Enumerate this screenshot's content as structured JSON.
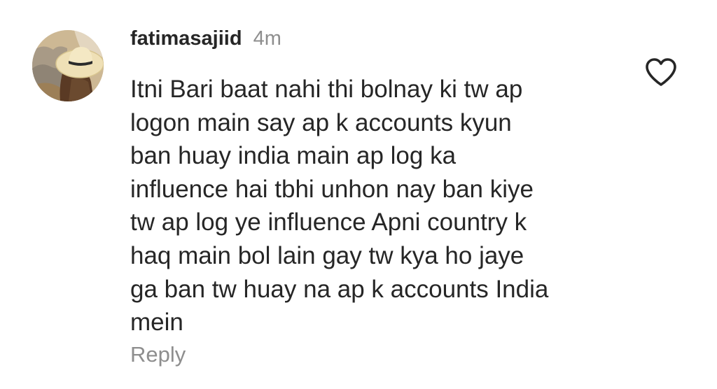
{
  "comment": {
    "username": "fatimasajiid",
    "timestamp": "4m",
    "text_lines": [
      "Itni Bari baat nahi thi bolnay ki tw ap",
      "logon main say ap k accounts kyun",
      "ban huay india main ap log ka",
      "influence hai tbhi unhon nay ban kiye",
      "tw ap log ye influence Apni country k",
      "haq main bol lain gay tw kya ho jaye",
      "ga ban tw huay na ap k accounts India",
      "mein"
    ],
    "reply_label": "Reply",
    "like_icon": "heart-outline-icon",
    "avatar_icon": "user-avatar-photo"
  },
  "colors": {
    "primary_text": "#262626",
    "secondary_text": "#8e8e8e",
    "background": "#ffffff"
  }
}
